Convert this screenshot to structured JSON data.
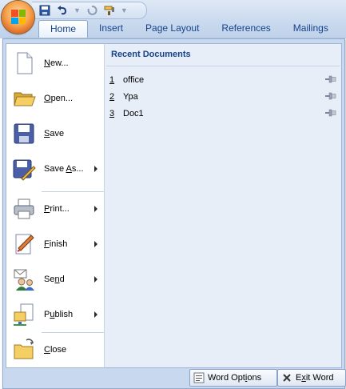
{
  "qat": {
    "icons": [
      "save-icon",
      "undo-icon",
      "redo-icon",
      "format-painter-icon",
      "customize-dropdown-icon"
    ]
  },
  "tabs": [
    "Home",
    "Insert",
    "Page Layout",
    "References",
    "Mailings"
  ],
  "menu": {
    "items": [
      {
        "pre": "",
        "accel": "N",
        "post": "ew...",
        "icon": "new-document-icon",
        "submenu": false
      },
      {
        "pre": "",
        "accel": "O",
        "post": "pen...",
        "icon": "open-folder-icon",
        "submenu": false
      },
      {
        "pre": "",
        "accel": "S",
        "post": "ave",
        "icon": "save-disk-icon",
        "submenu": false
      },
      {
        "pre": "Save ",
        "accel": "A",
        "post": "s...",
        "icon": "save-as-icon",
        "submenu": true
      },
      {
        "pre": "",
        "accel": "P",
        "post": "rint...",
        "icon": "printer-icon",
        "submenu": true
      },
      {
        "pre": "",
        "accel": "F",
        "post": "inish",
        "icon": "finish-pen-icon",
        "submenu": true
      },
      {
        "pre": "Se",
        "accel": "n",
        "post": "d",
        "icon": "send-people-icon",
        "submenu": true
      },
      {
        "pre": "P",
        "accel": "u",
        "post": "blish",
        "icon": "publish-icon",
        "submenu": true
      },
      {
        "pre": "",
        "accel": "C",
        "post": "lose",
        "icon": "close-folder-icon",
        "submenu": false
      }
    ]
  },
  "recent": {
    "title": "Recent Documents",
    "items": [
      {
        "num": "1",
        "name": "office"
      },
      {
        "num": "2",
        "name": "Ypa"
      },
      {
        "num": "3",
        "name": "Doc1"
      }
    ]
  },
  "footer": {
    "options": {
      "pre": "Word Opt",
      "accel": "i",
      "post": "ons",
      "icon": "options-icon"
    },
    "exit": {
      "pre": "E",
      "accel": "x",
      "post": "it Word",
      "icon": "exit-x-icon"
    }
  }
}
